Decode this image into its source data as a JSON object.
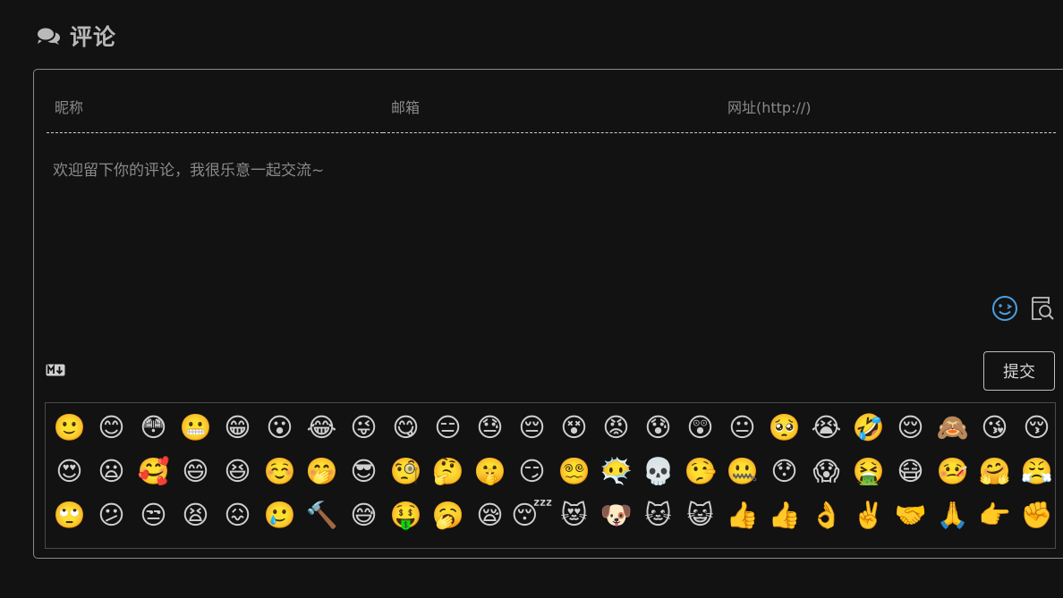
{
  "header": {
    "title": "评论",
    "icon": "comments-icon"
  },
  "form": {
    "nick_placeholder": "昵称",
    "mail_placeholder": "邮箱",
    "link_placeholder": "网址(http://)",
    "comment_placeholder": "欢迎留下你的评论，我很乐意一起交流~",
    "submit_label": "提交",
    "markdown_badge": "M↓"
  },
  "colors": {
    "accent": "#4a9fe0",
    "border": "#8a8a8a",
    "background": "#121212"
  },
  "emojis": [
    "🙂",
    "😊",
    "😳",
    "😬",
    "😁",
    "😮",
    "😂",
    "😜",
    "😋",
    "😑",
    "😓",
    "😔",
    "😵",
    "😡",
    "😰",
    "😲",
    "😐",
    "🥺",
    "😭",
    "🤣",
    "😌",
    "🙈",
    "😘",
    "😚",
    "😍",
    "😦",
    "🥰",
    "😄",
    "😆",
    "☺️",
    "🤭",
    "😎",
    "🧐",
    "🤔",
    "🤫",
    "😏",
    "😵‍💫",
    "😶‍🌫️",
    "💀",
    "🤥",
    "🤐",
    "😯",
    "😱",
    "🤮",
    "😷",
    "🤒",
    "🤗",
    "😤",
    "🙄",
    "😕",
    "😒",
    "😫",
    "😖",
    "🥲",
    "🔨",
    "😅",
    "🤑",
    "🥱",
    "😪",
    "😴",
    "😻",
    "🐶",
    "🐱",
    "😺",
    "👍",
    "👍",
    "👌",
    "✌️",
    "🤝",
    "🙏",
    "👉",
    "✊"
  ]
}
